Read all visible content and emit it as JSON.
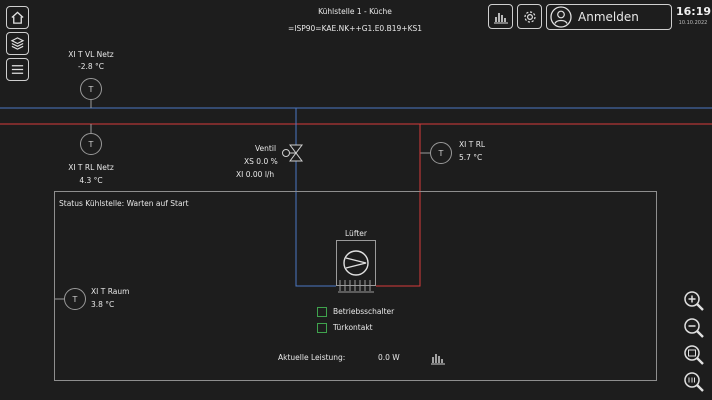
{
  "header": {
    "title": "Kühlstelle 1 - Küche",
    "code": "=ISP90=KAE.NK++G1.E0.B19+KS1",
    "login_label": "Anmelden",
    "time": "16:19",
    "date": "10.10.2022"
  },
  "left_nav": {
    "icons": [
      "home-icon",
      "layers-icon",
      "menu-icon"
    ]
  },
  "top_right_icons": [
    "chart-icon",
    "gear-icon",
    "user-icon"
  ],
  "sensors": {
    "vl_netz": {
      "label": "XI T VL Netz",
      "value": "-2.8 °C",
      "symbol": "T"
    },
    "rl_netz": {
      "label": "XI T RL Netz",
      "value": "4.3 °C",
      "symbol": "T"
    },
    "rl": {
      "label": "XI T RL",
      "value": "5.7 °C",
      "symbol": "T"
    },
    "raum": {
      "label": "XI T Raum",
      "value": "3.8 °C",
      "symbol": "T"
    }
  },
  "valve": {
    "label": "Ventil",
    "xs": "XS 0.0 %",
    "xi": "XI 0.00 l/h"
  },
  "panel": {
    "status": "Status Kühlstelle: Warten auf Start",
    "fan_label": "Lüfter",
    "checkboxes": [
      {
        "label": "Betriebsschalter",
        "checked": false
      },
      {
        "label": "Türkontakt",
        "checked": false
      }
    ],
    "power_label": "Aktuelle Leistung:",
    "power_value": "0.0 W"
  },
  "zoom_icons": [
    "zoom-in-icon",
    "zoom-out-icon",
    "zoom-fit-icon",
    "zoom-reset-icon"
  ],
  "colors": {
    "flow_line": "#4a78c4",
    "return_line": "#d63a3a",
    "checkbox_border": "#3fa34d"
  }
}
